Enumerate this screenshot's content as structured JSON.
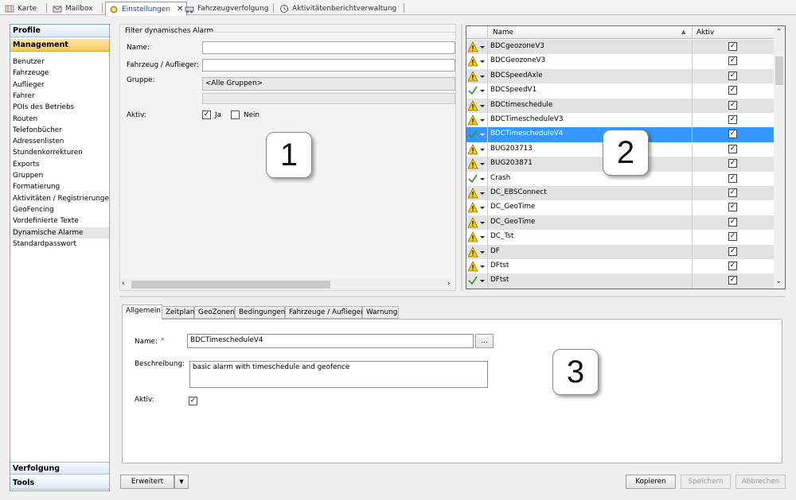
{
  "tabs": [
    {
      "label": "Karte",
      "icon": "map-icon"
    },
    {
      "label": "Mailbox",
      "icon": "mailbox-icon"
    },
    {
      "label": "Einstellungen",
      "icon": "settings-icon",
      "active": true
    },
    {
      "label": "Fahrzeugverfolgung",
      "icon": "vehicle-tracking-icon"
    },
    {
      "label": "Aktivitätenberichtverwaltung",
      "icon": "activity-report-icon"
    }
  ],
  "sidebar": {
    "profile": "Profile",
    "management": "Management",
    "items": [
      "Benutzer",
      "Fahrzeuge",
      "Auflieger",
      "Fahrer",
      "POIs des Betriebs",
      "Routen",
      "Telefonbücher",
      "Adressenlisten",
      "Stundenkorrekturen",
      "Exports",
      "Gruppen",
      "Formatierung",
      "Aktivitäten / Registrierungen",
      "GeoFencing",
      "Vordefinierte Texte",
      "Dynamische Alarme",
      "Standardpasswort"
    ],
    "selected_item": "Dynamische Alarme",
    "tracking": "Verfolgung",
    "tools": "Tools"
  },
  "filter": {
    "title": "Filter dynamisches Alarm",
    "name_label": "Name:",
    "vehicle_label": "Fahrzeug / Auflieger:",
    "group_label": "Gruppe:",
    "group_value": "<Alle Gruppen>",
    "active_label": "Aktiv:",
    "yes_label": "Ja",
    "yes_checked": true,
    "no_label": "Nein",
    "no_checked": false
  },
  "callouts": {
    "one": "1",
    "two": "2",
    "three": "3"
  },
  "grid": {
    "col_name": "Name",
    "col_active": "Aktiv",
    "rows": [
      {
        "name": "BDCgeozoneV3",
        "status": "warning",
        "active": true
      },
      {
        "name": "BDCGeozoneV3",
        "status": "warning",
        "active": true
      },
      {
        "name": "BDCSpeedAxle",
        "status": "warning",
        "active": true
      },
      {
        "name": "BDCSpeedV1",
        "status": "ok",
        "active": true
      },
      {
        "name": "BDCtimeschedule",
        "status": "warning",
        "active": true
      },
      {
        "name": "BDCTimescheduleV3",
        "status": "warning",
        "active": true
      },
      {
        "name": "BDCTimescheduleV4",
        "status": "ok",
        "active": true,
        "selected": true
      },
      {
        "name": "BUG203713",
        "status": "warning",
        "active": true
      },
      {
        "name": "BUG203871",
        "status": "warning",
        "active": true
      },
      {
        "name": "Crash",
        "status": "ok",
        "active": true
      },
      {
        "name": "DC_EBSConnect",
        "status": "warning",
        "active": true
      },
      {
        "name": "DC_GeoTime",
        "status": "warning",
        "active": true
      },
      {
        "name": "DC_GeoTime",
        "status": "warning",
        "active": true
      },
      {
        "name": "DC_Tst",
        "status": "warning",
        "active": true
      },
      {
        "name": "DF",
        "status": "warning",
        "active": true
      },
      {
        "name": "DFtst",
        "status": "warning",
        "active": true
      },
      {
        "name": "DFtst",
        "status": "ok",
        "active": true
      }
    ]
  },
  "detail": {
    "tabs": [
      "Allgemein",
      "Zeitplan",
      "GeoZonen",
      "Bedingungen",
      "Fahrzeuge / Auflieger",
      "Warnung"
    ],
    "name_label": "Name:",
    "required_mark": "*",
    "name_value": "BDCTimescheduleV4",
    "browse_label": "...",
    "description_label": "Beschreibung:",
    "description_value": "basic alarm with timeschedule and geofence",
    "active_label": "Aktiv:",
    "active_checked": true
  },
  "footer": {
    "advanced_label": "Erweitert",
    "copy_label": "Kopieren",
    "save_label": "Speichern",
    "cancel_label": "Abbrechen"
  },
  "colors": {
    "selection": "#3399ff",
    "nav_active": "#f6c75a",
    "warning": "#f5d000",
    "ok": "#2e9e2e",
    "required": "#e02020"
  }
}
